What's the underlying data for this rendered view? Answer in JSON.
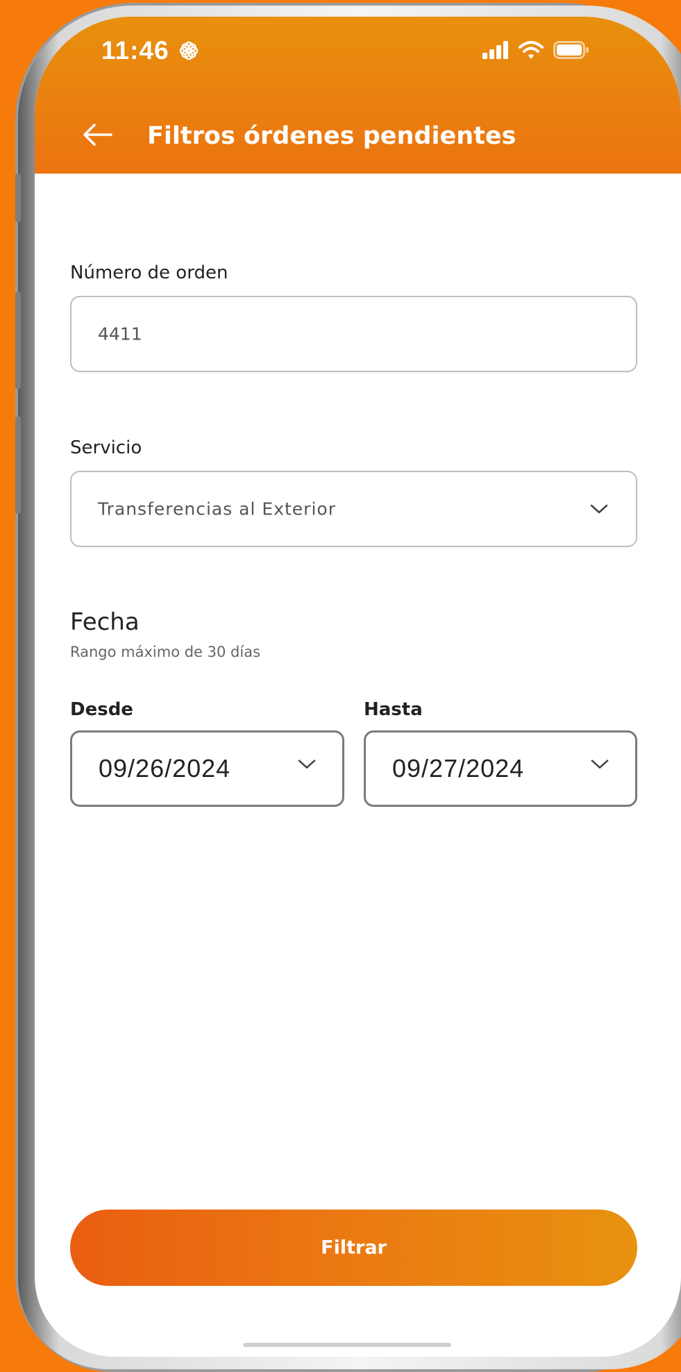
{
  "status_bar": {
    "time": "11:46",
    "icons": [
      "flower-icon",
      "signal-icon",
      "wifi-icon",
      "battery-icon"
    ]
  },
  "header": {
    "title": "Filtros órdenes pendientes",
    "back_icon": "arrow-left-icon"
  },
  "form": {
    "order_number": {
      "label": "Número de orden",
      "value": "4411"
    },
    "service": {
      "label": "Servicio",
      "selected": "Transferencias al Exterior"
    },
    "date": {
      "title": "Fecha",
      "hint": "Rango máximo de 30 días",
      "from": {
        "label": "Desde",
        "value": "09/26/2024"
      },
      "to": {
        "label": "Hasta",
        "value": "09/27/2024"
      }
    }
  },
  "actions": {
    "filter_label": "Filtrar"
  },
  "colors": {
    "brand_orange": "#ec7310",
    "background": "#f77b0a",
    "field_border": "#bdbdbd",
    "date_border": "#7a7a7a"
  }
}
